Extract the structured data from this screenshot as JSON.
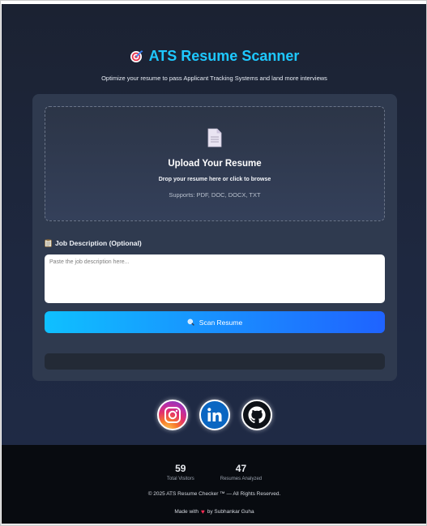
{
  "header": {
    "title": "ATS Resume Scanner",
    "subtitle": "Optimize your resume to pass Applicant Tracking Systems and land more interviews",
    "title_icon": "target-icon"
  },
  "upload": {
    "icon": "document-icon",
    "title": "Upload Your Resume",
    "hint": "Drop your resume here or click to browse",
    "formats": "Supports: PDF, DOC, DOCX, TXT"
  },
  "job_description": {
    "icon": "clipboard-icon",
    "label": "Job Description (Optional)",
    "placeholder": "Paste the job description here...",
    "value": ""
  },
  "scan_button": {
    "icon": "search-icon",
    "label": "Scan Resume"
  },
  "socials": [
    {
      "name": "instagram-icon"
    },
    {
      "name": "linkedin-icon"
    },
    {
      "name": "github-icon"
    }
  ],
  "footer": {
    "stats": [
      {
        "value": "59",
        "label": "Total Visitors"
      },
      {
        "value": "47",
        "label": "Resumes Analyzed"
      }
    ],
    "copyright": "© 2025 ATS Resume Checker ™ — All Rights Reserved.",
    "made_with_prefix": "Made with",
    "made_with_suffix": "by Subhankar Guha"
  },
  "colors": {
    "accent": "#1ec8ff",
    "button_start": "#0fc0ff",
    "button_end": "#1f63ff",
    "heart": "#ff2d55"
  }
}
